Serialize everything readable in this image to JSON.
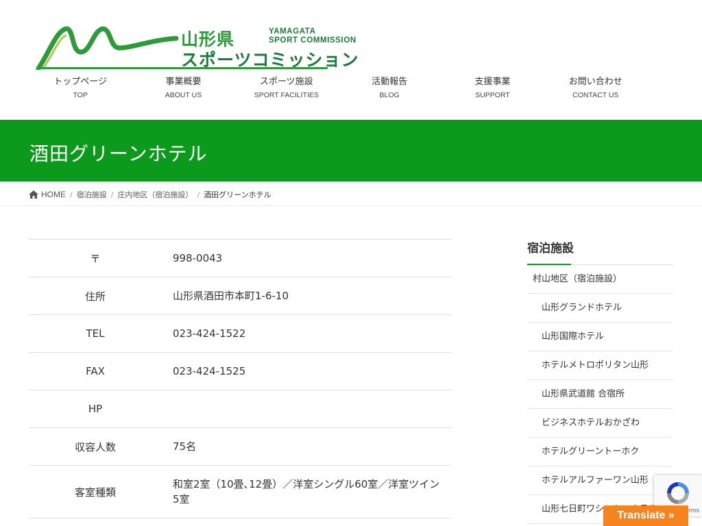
{
  "logo": {
    "title": "山形県",
    "title_en_line1": "YAMAGATA",
    "title_en_line2": "SPORT COMMISSION",
    "subtitle": "スポーツコミッション"
  },
  "nav": [
    {
      "jp": "トップページ",
      "en": "TOP"
    },
    {
      "jp": "事業概要",
      "en": "ABOUT US"
    },
    {
      "jp": "スポーツ施設",
      "en": "SPORT FACILITIES"
    },
    {
      "jp": "活動報告",
      "en": "BLOG"
    },
    {
      "jp": "支援事業",
      "en": "SUPPORT"
    },
    {
      "jp": "お問い合わせ",
      "en": "CONTACT US"
    }
  ],
  "page_title": "酒田グリーンホテル",
  "breadcrumb": {
    "home": "HOME",
    "items": [
      "宿泊施設",
      "庄内地区（宿泊施設）"
    ],
    "current": "酒田グリーンホテル",
    "separator": "/"
  },
  "info": [
    {
      "label": "〒",
      "value": "998-0043"
    },
    {
      "label": "住所",
      "value": "山形県酒田市本町1-6-10"
    },
    {
      "label": "TEL",
      "value": "023-424-1522"
    },
    {
      "label": "FAX",
      "value": "023-424-1525"
    },
    {
      "label": "HP",
      "value": ""
    },
    {
      "label": "収容人数",
      "value": "75名"
    },
    {
      "label": "客室種類",
      "value": "和室2室（10畳､12畳）／洋室シングル60室／洋室ツイン5室"
    }
  ],
  "sidebar": {
    "title": "宿泊施設",
    "items": [
      {
        "label": "村山地区（宿泊施設）",
        "level": 1
      },
      {
        "label": "山形グランドホテル",
        "level": 2
      },
      {
        "label": "山形国際ホテル",
        "level": 2
      },
      {
        "label": "ホテルメトロポリタン山形",
        "level": 2
      },
      {
        "label": "山形県武道館 合宿所",
        "level": 2
      },
      {
        "label": "ビジネスホテルおかざわ",
        "level": 2
      },
      {
        "label": "ホテルグリーントーホク",
        "level": 2
      },
      {
        "label": "ホテルアルファーワン山形",
        "level": 2
      },
      {
        "label": "山形七日町ワシントンホテル",
        "level": 2
      }
    ]
  },
  "recaptcha": {
    "text": "- Terms"
  },
  "translate": {
    "label": "Translate »"
  },
  "colors": {
    "brand_green": "#0c9a1c",
    "translate_orange": "#f5841f"
  }
}
